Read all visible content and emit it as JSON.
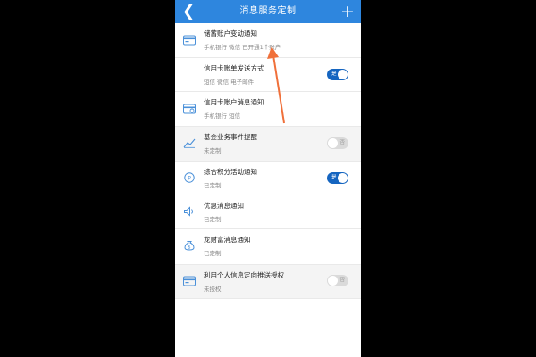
{
  "header": {
    "title": "消息服务定制",
    "back_icon": "chevron-left-icon",
    "add_icon": "plus-icon",
    "color": "#2e86de"
  },
  "rows": [
    {
      "title": "储蓄账户变动通知",
      "subtitle": "手机银行 微信 已开通1个账户",
      "icon": "card-icon"
    },
    {
      "title": "信用卡账单发送方式",
      "subtitle": "短信 微信 电子邮件",
      "toggle": "on",
      "toggle_label": "是"
    },
    {
      "title": "信用卡账户消息通知",
      "subtitle": "手机银行 短信",
      "icon": "card-message-icon"
    },
    {
      "title": "基金业务事件提醒",
      "subtitle": "未定制",
      "toggle": "off",
      "toggle_label": "否",
      "icon": "fund-chart-icon"
    },
    {
      "title": "综合积分活动通知",
      "subtitle": "已定制",
      "toggle": "on",
      "toggle_label": "是",
      "icon": "points-icon"
    },
    {
      "title": "优惠消息通知",
      "subtitle": "已定制",
      "icon": "speaker-icon"
    },
    {
      "title": "龙财富消息通知",
      "subtitle": "已定制",
      "icon": "money-bag-icon"
    },
    {
      "title": "利用个人信息定向推送授权",
      "subtitle": "未授权",
      "toggle": "off",
      "toggle_label": "否",
      "icon": "card-icon"
    }
  ],
  "colors": {
    "toggle_on": "#1565c0",
    "toggle_off": "#dadada",
    "annotation_arrow": "#f0703a"
  }
}
